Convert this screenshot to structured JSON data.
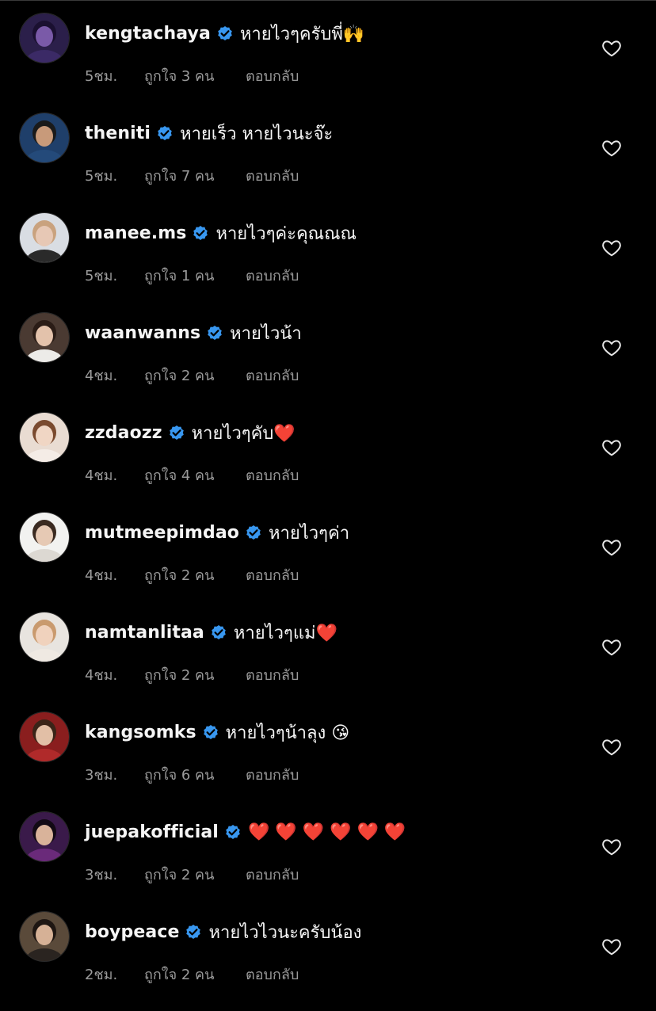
{
  "colors": {
    "background": "#000000",
    "primary_text": "#f5f5f5",
    "secondary_text": "#9a9a9a",
    "verified_badge": "#3897f0",
    "heart_outline": "#e6e6e6"
  },
  "comments": [
    {
      "username": "kengtachaya",
      "text": "หายไวๆครับพี่🙌",
      "time": "5ชม.",
      "likes": "ถูกใจ 3 คน",
      "reply": "ตอบกลับ",
      "avatar": {
        "bg": "#2b1f4a",
        "face": "#7a5aa8",
        "hair": "#1a1030",
        "shirt": "#3b2a66"
      }
    },
    {
      "username": "theniti",
      "text": "หายเร็ว หายไวนะจ๊ะ",
      "time": "5ชม.",
      "likes": "ถูกใจ 7 คน",
      "reply": "ตอบกลับ",
      "avatar": {
        "bg": "#1f3f6a",
        "face": "#c89a7a",
        "hair": "#1a1a1a",
        "shirt": "#244a7a"
      }
    },
    {
      "username": "manee.ms",
      "text": "หายไวๆค่ะคุณณณ",
      "time": "5ชม.",
      "likes": "ถูกใจ 1 คน",
      "reply": "ตอบกลับ",
      "avatar": {
        "bg": "#d9dde3",
        "face": "#e7c8b5",
        "hair": "#c9a27e",
        "shirt": "#2a2a2a"
      }
    },
    {
      "username": "waanwanns",
      "text": "หายไวน้า",
      "time": "4ชม.",
      "likes": "ถูกใจ 2 คน",
      "reply": "ตอบกลับ",
      "avatar": {
        "bg": "#4a3a32",
        "face": "#e3c2ab",
        "hair": "#2a1c16",
        "shirt": "#ecebe8"
      }
    },
    {
      "username": "zzdaozz",
      "text": "หายไวๆคับ❤️",
      "time": "4ชม.",
      "likes": "ถูกใจ 4 คน",
      "reply": "ตอบกลับ",
      "avatar": {
        "bg": "#e9dcd2",
        "face": "#f0d6c4",
        "hair": "#7a4a2e",
        "shirt": "#f4ece6"
      }
    },
    {
      "username": "mutmeepimdao",
      "text": "หายไวๆค่า",
      "time": "4ชม.",
      "likes": "ถูกใจ 2 คน",
      "reply": "ตอบกลับ",
      "avatar": {
        "bg": "#f2f2f0",
        "face": "#e6c9b4",
        "hair": "#3a2a20",
        "shirt": "#dcd8d2"
      }
    },
    {
      "username": "namtanlitaa",
      "text": "หายไวๆแม่❤️",
      "time": "4ชม.",
      "likes": "ถูกใจ 2 คน",
      "reply": "ตอบกลับ",
      "avatar": {
        "bg": "#e8e4df",
        "face": "#f0d2bd",
        "hair": "#c99a6e",
        "shirt": "#efe9e2"
      }
    },
    {
      "username": "kangsomks",
      "text": "หายไวๆน้าลุง 😘",
      "time": "3ชม.",
      "likes": "ถูกใจ 6 คน",
      "reply": "ตอบกลับ",
      "avatar": {
        "bg": "#8a1e1e",
        "face": "#e2bfa6",
        "hair": "#3a2418",
        "shirt": "#b02a2a"
      }
    },
    {
      "username": "juepakofficial",
      "text": "❤️ ❤️ ❤️ ❤️ ❤️ ❤️",
      "time": "3ชม.",
      "likes": "ถูกใจ 2 คน",
      "reply": "ตอบกลับ",
      "avatar": {
        "bg": "#3a1a4a",
        "face": "#d9b39a",
        "hair": "#120a14",
        "shirt": "#6a2a7a"
      }
    },
    {
      "username": "boypeace",
      "text": "หายไวไวนะครับน้อง",
      "time": "2ชม.",
      "likes": "ถูกใจ 2 คน",
      "reply": "ตอบกลับ",
      "avatar": {
        "bg": "#5a4a3a",
        "face": "#d6b196",
        "hair": "#1e1612",
        "shirt": "#2a2420"
      }
    }
  ]
}
